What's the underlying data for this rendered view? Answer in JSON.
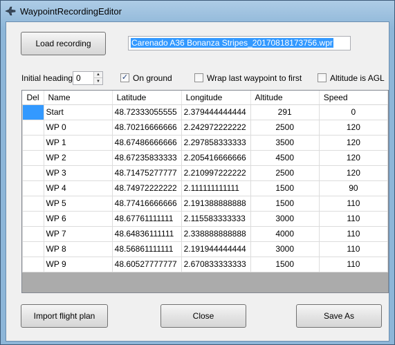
{
  "window": {
    "title": "WaypointRecordingEditor"
  },
  "toolbar": {
    "load_label": "Load recording",
    "filename": "Carenado A36 Bonanza Stripes_20170818173756.wpr"
  },
  "options": {
    "initial_heading_label": "Initial heading",
    "initial_heading_value": "0",
    "on_ground_label": "On ground",
    "on_ground_checked": true,
    "wrap_label": "Wrap last waypoint to first",
    "wrap_checked": false,
    "agl_label": "Altitude is AGL",
    "agl_checked": false
  },
  "grid": {
    "columns": [
      "Del",
      "Name",
      "Latitude",
      "Longitude",
      "Altitude",
      "Speed"
    ],
    "rows": [
      {
        "name": "Start",
        "lat": "48.72333055555",
        "lon": "2.379444444444",
        "alt": "291",
        "speed": "0"
      },
      {
        "name": "WP 0",
        "lat": "48.70216666666",
        "lon": "2.242972222222",
        "alt": "2500",
        "speed": "120"
      },
      {
        "name": "WP 1",
        "lat": "48.67486666666",
        "lon": "2.297858333333",
        "alt": "3500",
        "speed": "120"
      },
      {
        "name": "WP 2",
        "lat": "48.67235833333",
        "lon": "2.205416666666",
        "alt": "4500",
        "speed": "120"
      },
      {
        "name": "WP 3",
        "lat": "48.71475277777",
        "lon": "2.210997222222",
        "alt": "2500",
        "speed": "120"
      },
      {
        "name": "WP 4",
        "lat": "48.74972222222",
        "lon": "2.111111111111",
        "alt": "1500",
        "speed": "90"
      },
      {
        "name": "WP 5",
        "lat": "48.77416666666",
        "lon": "2.191388888888",
        "alt": "1500",
        "speed": "110"
      },
      {
        "name": "WP 6",
        "lat": "48.67761111111",
        "lon": "2.115583333333",
        "alt": "3000",
        "speed": "110"
      },
      {
        "name": "WP 7",
        "lat": "48.64836111111",
        "lon": "2.338888888888",
        "alt": "4000",
        "speed": "110"
      },
      {
        "name": "WP 8",
        "lat": "48.56861111111",
        "lon": "2.191944444444",
        "alt": "3000",
        "speed": "110"
      },
      {
        "name": "WP 9",
        "lat": "48.60527777777",
        "lon": "2.670833333333",
        "alt": "1500",
        "speed": "110"
      }
    ]
  },
  "footer": {
    "import_label": "Import flight plan",
    "close_label": "Close",
    "save_label": "Save As"
  }
}
